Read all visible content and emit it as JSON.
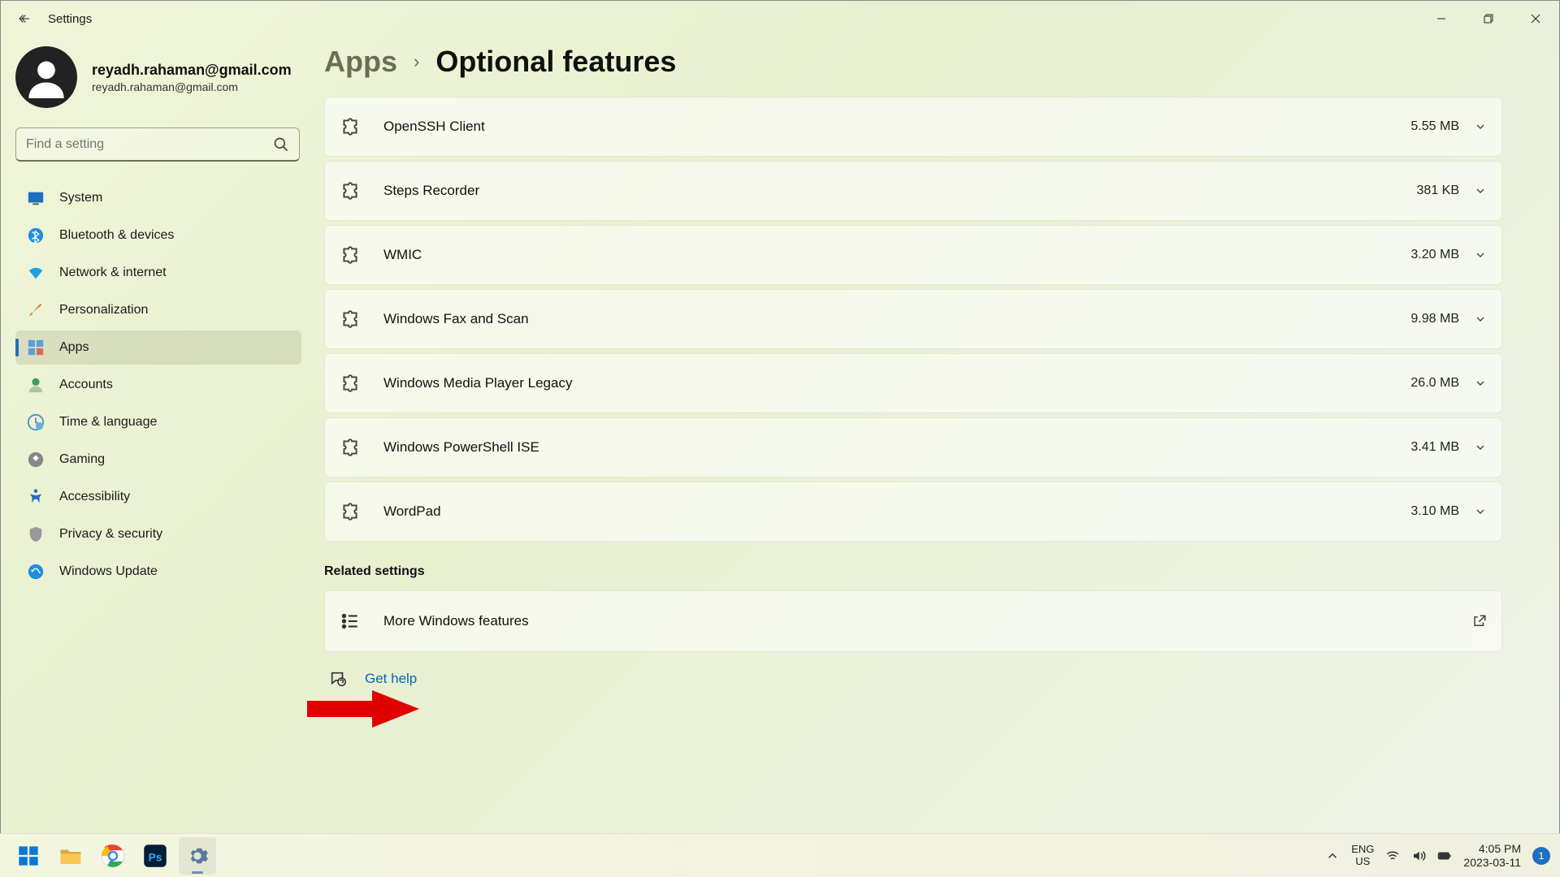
{
  "window": {
    "title": "Settings"
  },
  "profile": {
    "name": "reyadh.rahaman@gmail.com",
    "sub": "reyadh.rahaman@gmail.com"
  },
  "search": {
    "placeholder": "Find a setting"
  },
  "nav": {
    "items": [
      {
        "label": "System"
      },
      {
        "label": "Bluetooth & devices"
      },
      {
        "label": "Network & internet"
      },
      {
        "label": "Personalization"
      },
      {
        "label": "Apps"
      },
      {
        "label": "Accounts"
      },
      {
        "label": "Time & language"
      },
      {
        "label": "Gaming"
      },
      {
        "label": "Accessibility"
      },
      {
        "label": "Privacy & security"
      },
      {
        "label": "Windows Update"
      }
    ],
    "active_index": 4
  },
  "breadcrumb": {
    "parent": "Apps",
    "current": "Optional features"
  },
  "features": [
    {
      "name": "OpenSSH Client",
      "size": "5.55 MB"
    },
    {
      "name": "Steps Recorder",
      "size": "381 KB"
    },
    {
      "name": "WMIC",
      "size": "3.20 MB"
    },
    {
      "name": "Windows Fax and Scan",
      "size": "9.98 MB"
    },
    {
      "name": "Windows Media Player Legacy",
      "size": "26.0 MB"
    },
    {
      "name": "Windows PowerShell ISE",
      "size": "3.41 MB"
    },
    {
      "name": "WordPad",
      "size": "3.10 MB"
    }
  ],
  "related_section": {
    "title": "Related settings",
    "item": "More Windows features"
  },
  "help": {
    "label": "Get help"
  },
  "taskbar": {
    "lang1": "ENG",
    "lang2": "US",
    "time": "4:05 PM",
    "date": "2023-03-11",
    "notif": "1"
  }
}
